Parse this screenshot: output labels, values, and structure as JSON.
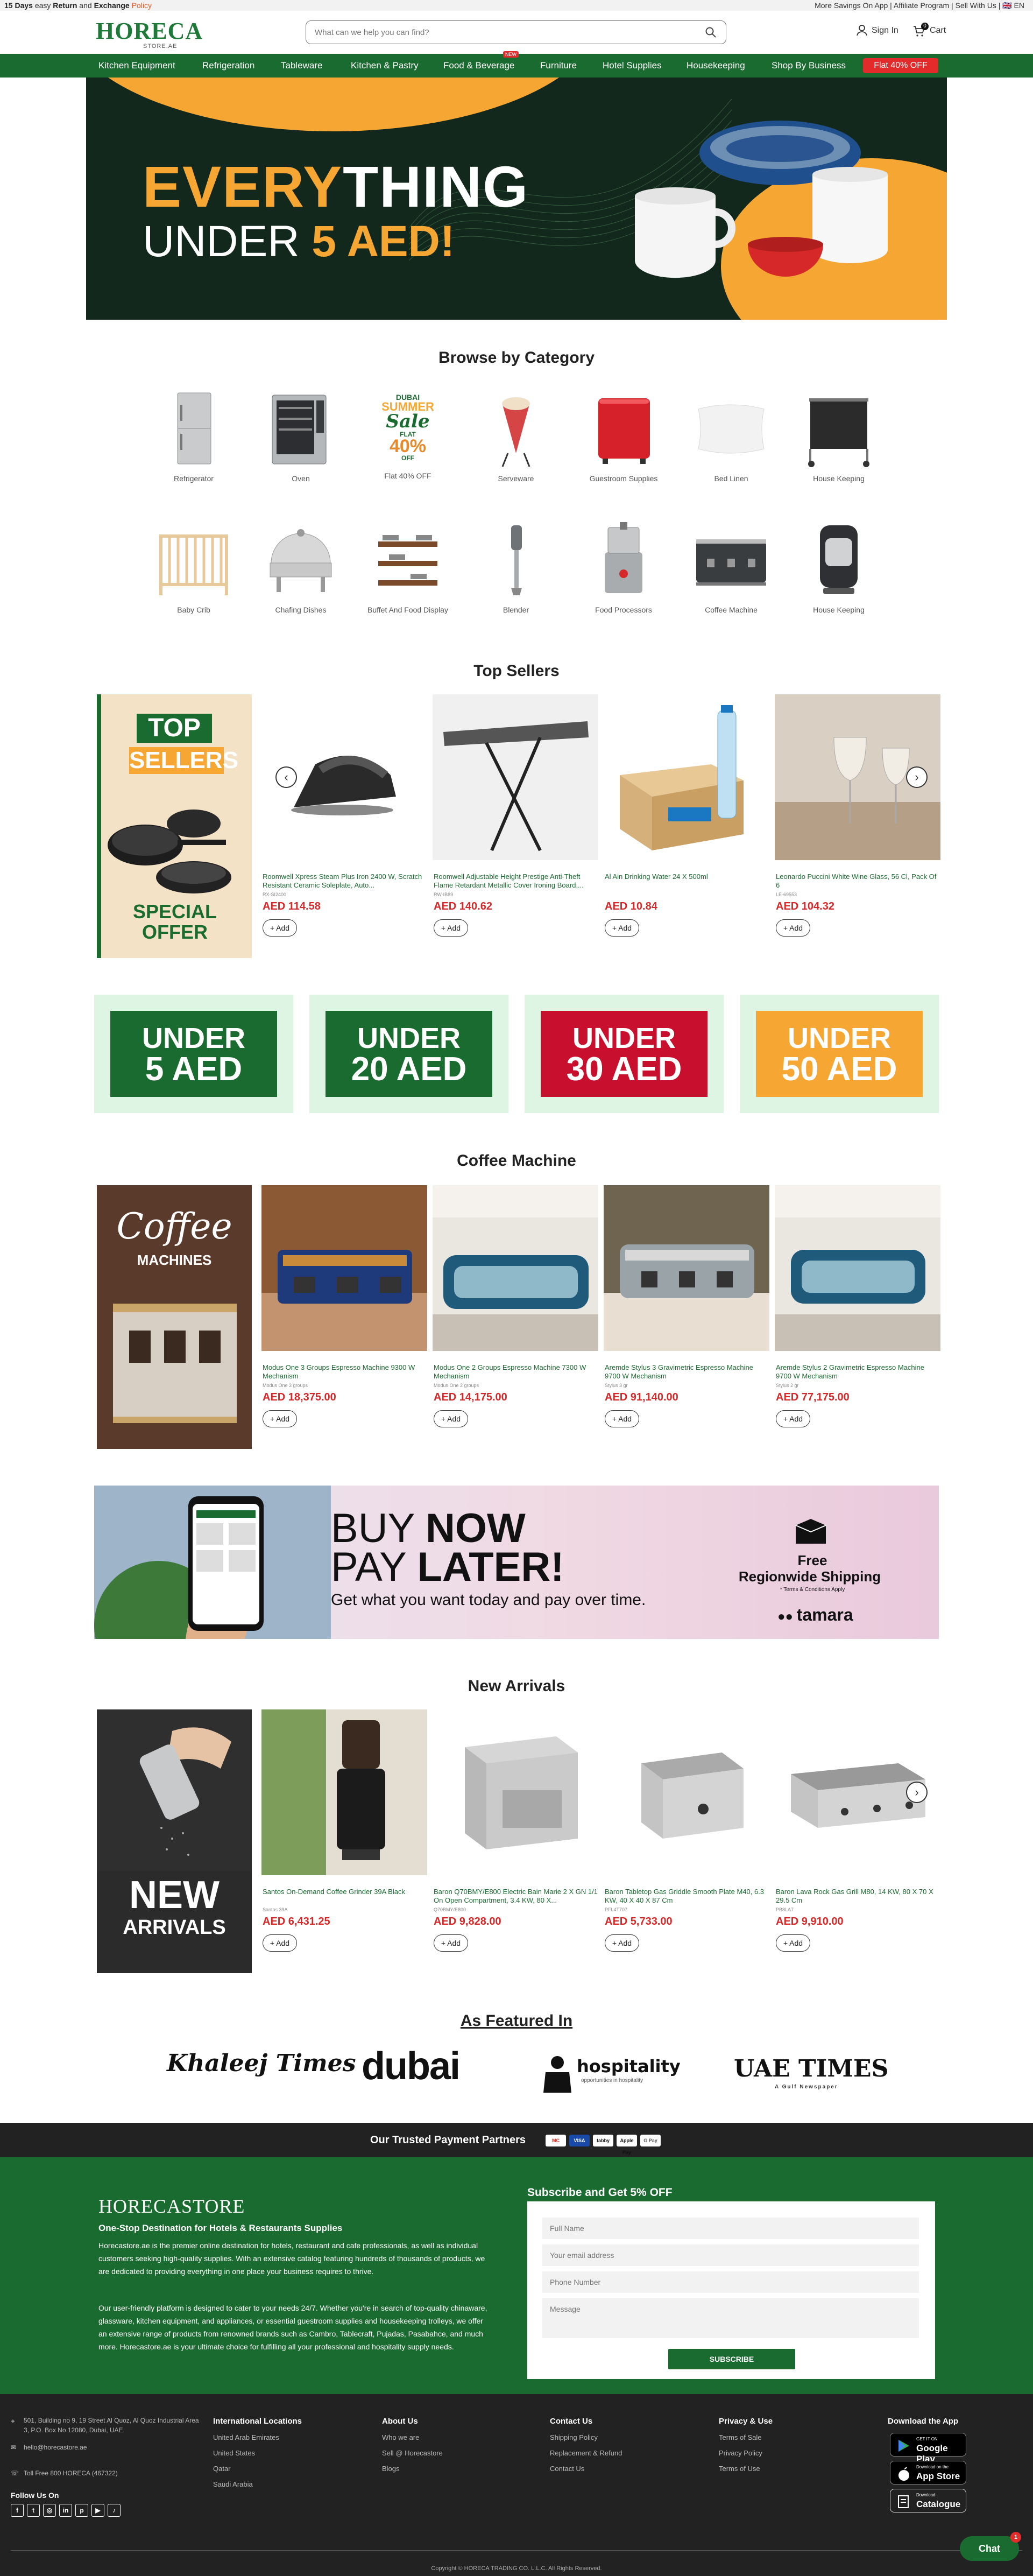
{
  "topbar": {
    "left_prefix": "15 Days",
    "left_mid": " easy ",
    "left_return": "Return",
    "left_and": " and ",
    "left_exchange": "Exchange",
    "left_policy": " Policy",
    "right": "More Savings On App | Affiliate Program | Sell With Us | 🇬🇧 EN"
  },
  "header": {
    "logo_main": "HORECA",
    "logo_sub": "STORE.AE",
    "search_placeholder": "What can we help you can find?",
    "signin": "Sign In",
    "cart": "Cart",
    "cart_count": "0"
  },
  "nav": {
    "items": [
      "Kitchen Equipment",
      "Refrigeration",
      "Tableware",
      "Kitchen & Pastry",
      "Food & Beverage",
      "Furniture",
      "Hotel Supplies",
      "Housekeeping",
      "Shop By Business"
    ],
    "flat": "Flat 40% OFF",
    "new_badge": "NEW"
  },
  "hero": {
    "line1_a": "EVERY",
    "line1_b": "THING",
    "line2_a": "UNDER ",
    "line2_b": "5 AED!"
  },
  "categories": {
    "title": "Browse by Category",
    "items": [
      "Refrigerator",
      "Oven",
      "Flat 40% OFF",
      "Serveware",
      "Guestroom Supplies",
      "Bed Linen",
      "House Keeping",
      "Baby Crib",
      "Chafing Dishes",
      "Buffet And Food Display",
      "Blender",
      "Food Processors",
      "Coffee Machine",
      "House Keeping"
    ],
    "sale_badge": {
      "top": "DUBAI",
      "mid": "SUMMER",
      "script": "Sale",
      "flat": "FLAT",
      "pct": "40%",
      "off": "OFF"
    }
  },
  "top_sellers": {
    "title": "Top Sellers",
    "promo": {
      "line1": "TOP",
      "line2": "SELLERS",
      "line3": "SPECIAL",
      "line4": "OFFER"
    },
    "products": [
      {
        "name": "Roomwell Xpress Steam Plus Iron 2400 W, Scratch Resistant Ceramic Soleplate, Auto...",
        "sku": "RX-SI2400",
        "price": "AED 114.58"
      },
      {
        "name": "Roomwell Adjustable Height Prestige Anti-Theft Flame Retardant Metallic Cover Ironing Board,...",
        "sku": "RW-IB89",
        "price": "AED 140.62"
      },
      {
        "name": "Al Ain Drinking Water 24 X 500ml",
        "sku": "AIN-24X500",
        "price": "AED 10.84"
      },
      {
        "name": "Leonardo Puccini White Wine Glass, 56 Cl, Pack Of 6",
        "sku": "LE-69553",
        "price": "AED 104.32"
      }
    ],
    "add_label": "+ Add"
  },
  "under": [
    {
      "a": "UNDER",
      "b": "5 AED",
      "color": "#1a6b30"
    },
    {
      "a": "UNDER",
      "b": "20 AED",
      "color": "#1a6b30"
    },
    {
      "a": "UNDER",
      "b": "30 AED",
      "color": "#c8102e"
    },
    {
      "a": "UNDER",
      "b": "50 AED",
      "color": "#f6a733"
    }
  ],
  "coffee": {
    "title": "Coffee Machine",
    "promo": {
      "line1": "Coffee",
      "line2": "MACHINES"
    },
    "products": [
      {
        "name": "Modus One 3 Groups Espresso Machine 9300 W Mechanism",
        "sku": "Modus One 3 groups",
        "price": "AED 18,375.00"
      },
      {
        "name": "Modus One 2 Groups Espresso Machine 7300 W Mechanism",
        "sku": "Modus One 2 groups",
        "price": "AED 14,175.00"
      },
      {
        "name": "Aremde Stylus 3 Gravimetric Espresso Machine 9700 W Mechanism",
        "sku": "Stylus 3 gr",
        "price": "AED 91,140.00"
      },
      {
        "name": "Aremde Stylus 2 Gravimetric Espresso Machine 9700 W Mechanism",
        "sku": "Stylus 2 gr",
        "price": "AED 77,175.00"
      }
    ]
  },
  "bnpl": {
    "line1_a": "BUY ",
    "line1_b": "NOW",
    "line2_a": "PAY ",
    "line2_b": "LATER!",
    "sub": "Get what you want today and pay over time.",
    "ship1": "Free",
    "ship2": "Regionwide Shipping",
    "ship3": "* Terms & Conditions Apply",
    "brand": "tamara"
  },
  "new_arrivals": {
    "title": "New Arrivals",
    "promo": {
      "line1": "NEW",
      "line2": "ARRIVALS"
    },
    "products": [
      {
        "name": "Santos On-Demand Coffee Grinder 39A Black",
        "sku": "Santos 39A",
        "price": "AED 6,431.25"
      },
      {
        "name": "Baron Q70BMY/E800 Electric Bain Marie 2 X GN 1/1 On Open Compartment, 3.4 KW, 80 X...",
        "sku": "Q70BMY/E800",
        "price": "AED 9,828.00"
      },
      {
        "name": "Baron Tabletop Gas Griddle Smooth Plate M40, 6.3 KW, 40 X 40 X 87 Cm",
        "sku": "PFL4T707",
        "price": "AED 5,733.00"
      },
      {
        "name": "Baron Lava Rock Gas Grill M80, 14 KW, 80 X 70 X 29.5 Cm",
        "sku": "PB8LA7",
        "price": "AED 9,910.00"
      }
    ]
  },
  "featured": {
    "title": "As Featured In",
    "logos": [
      "Khaleej Times",
      "dubai",
      "hospitality",
      "UAE TIMES"
    ],
    "hosp_sub": "opportunities in hospitality",
    "uae_sub": "A Gulf Newspaper"
  },
  "payments": {
    "title": "Our Trusted Payment Partners",
    "cards": [
      "MC",
      "VISA",
      "tabby",
      "Apple Pay",
      "G Pay"
    ]
  },
  "footer": {
    "logo": "HORECASTORE",
    "tagline": "One-Stop Destination for Hotels & Restaurants Supplies",
    "p1": "Horecastore.ae is the premier online  destination for hotels, restaurant and cafe professionals, as well as individual customers seeking high-quality supplies. With an extensive catalog featuring hundreds of thousands of products, we are dedicated to providing everything in one place your business requires to thrive.",
    "p2": "Our user-friendly platform is designed to cater to your needs 24/7. Whether you're in search of top-quality chinaware, glassware, kitchen equipment, and appliances, or essential guestroom supplies and housekeeping trolleys, we offer an extensive range of products from renowned brands such as Cambro, Tablecraft, Pujadas, Pasabahce, and much more. Horecastore.ae is your ultimate choice for fulfilling all your professional and hospitality supply needs.",
    "subscribe_title": "Subscribe and Get 5% OFF",
    "fields": [
      "Full Name",
      "Your email address",
      "Phone Number",
      "Message"
    ],
    "subscribe_btn": "SUBSCRIBE"
  },
  "bottom": {
    "address": "501, Building no 9, 19 Street Al Quoz, Al Quoz Industrial Area 3, P.O. Box No 12080, Dubai, UAE.",
    "email": "hello@horecastore.ae",
    "phone": "Toll Free 800 HORECA (467322)",
    "follow": "Follow Us On",
    "cols": [
      {
        "h": "International Locations",
        "items": [
          "United Arab Emirates",
          "United States",
          "Qatar",
          "Saudi Arabia"
        ]
      },
      {
        "h": "About Us",
        "items": [
          "Who we are",
          "Sell @ Horecastore",
          "Blogs"
        ]
      },
      {
        "h": "Contact Us",
        "items": [
          "Shipping Policy",
          "Replacement & Refund",
          "Contact Us"
        ]
      },
      {
        "h": "Privacy & Use",
        "items": [
          "Terms of Sale",
          "Privacy Policy",
          "Terms of Use"
        ]
      }
    ],
    "download": "Download the App",
    "gp_small": "GET IT ON",
    "gp_big": "Google Play",
    "as_small": "Download on the",
    "as_big": "App Store",
    "cat_small": "Download",
    "cat_big": "Catalogue",
    "copyright": "Copyright © HORECA TRADING CO. L.L.C. All Rights Reserved.",
    "chat": "Chat",
    "chat_count": "1"
  }
}
